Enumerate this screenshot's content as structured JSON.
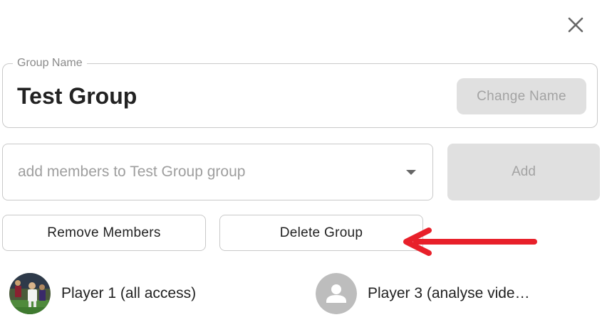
{
  "dialog": {
    "close_icon": "close-icon"
  },
  "group": {
    "name_label": "Group Name",
    "name_value": "Test Group",
    "change_name_button": "Change Name"
  },
  "add_members": {
    "placeholder": "add members to Test Group group",
    "add_button": "Add",
    "dropdown_icon": "chevron-down-icon"
  },
  "actions": {
    "remove_members_button": "Remove Members",
    "delete_group_button": "Delete Group"
  },
  "annotation": {
    "arrow_color": "#e8202a"
  },
  "members": [
    {
      "name": "Player 1 (all access)",
      "avatar": "photo"
    },
    {
      "name": "Player 3 (analyse vide…",
      "avatar": "default-person-icon"
    }
  ]
}
